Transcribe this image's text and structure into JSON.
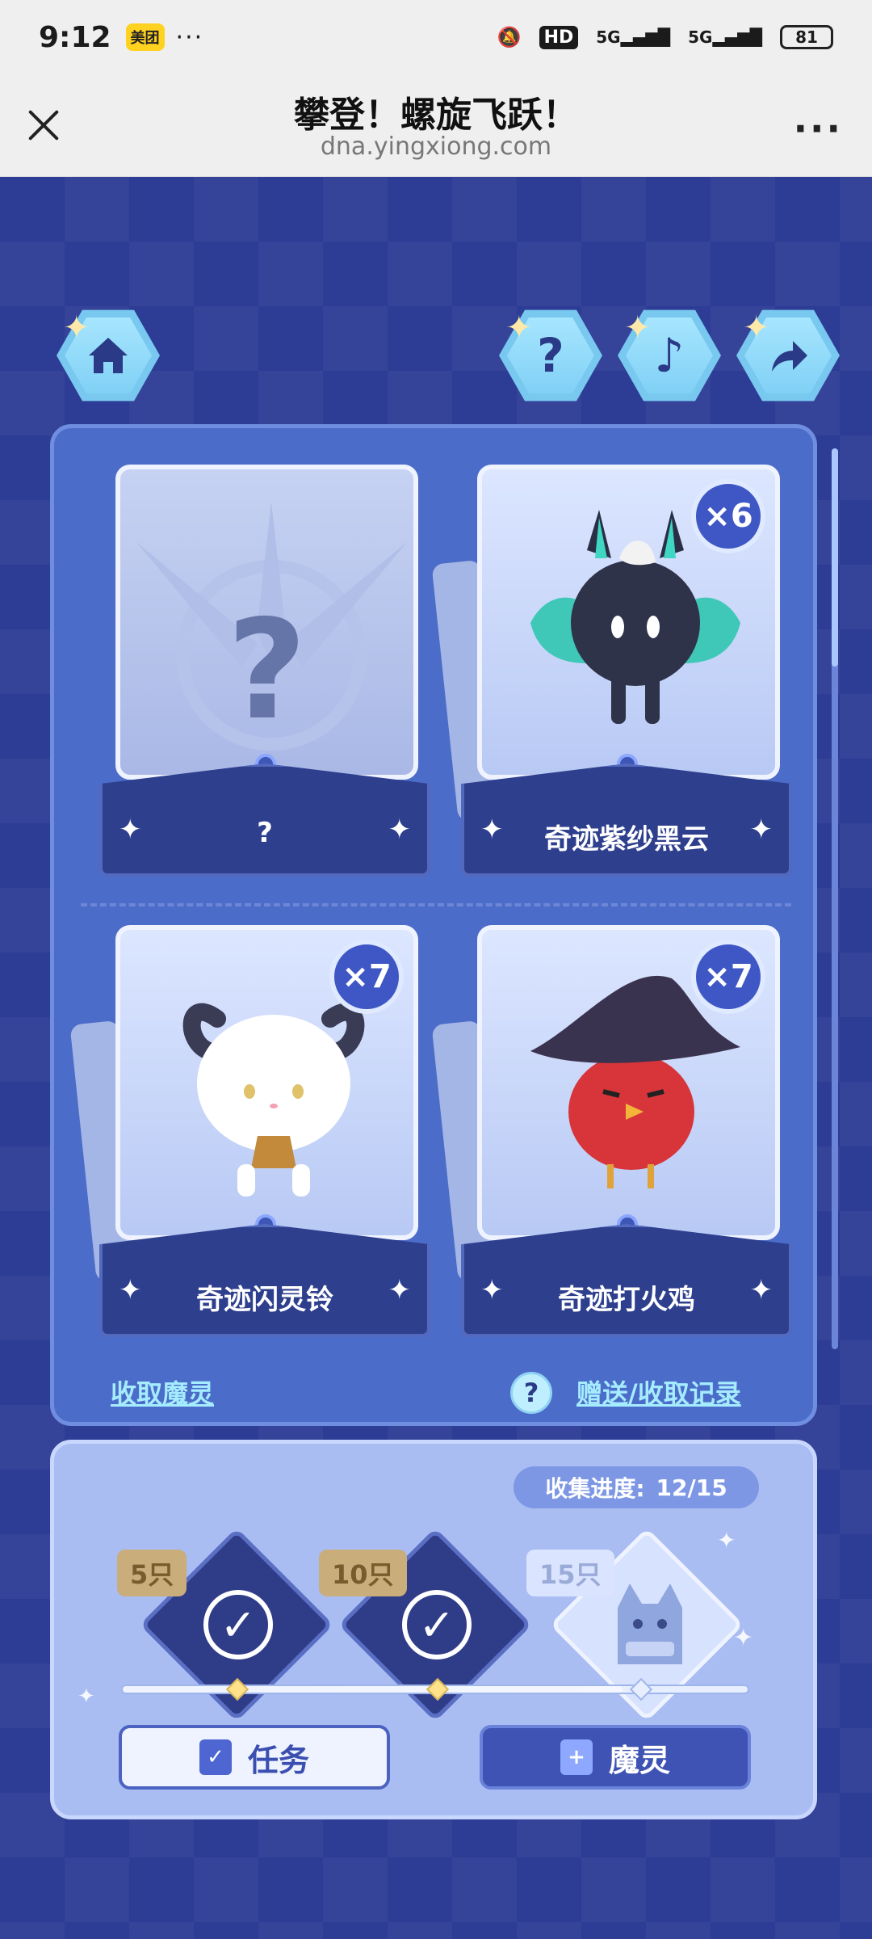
{
  "status_bar": {
    "time": "9:12",
    "app_badge": "美团",
    "more": "···",
    "network_1": "5G",
    "network_2": "5G",
    "hd": "HD",
    "battery": "81"
  },
  "title_bar": {
    "title": "攀登！螺旋飞跃！",
    "url": "dna.yingxiong.com",
    "more": "···"
  },
  "top_icons": {
    "home": "home-icon",
    "help": "?",
    "music": "♪",
    "share": "share-icon"
  },
  "cards": [
    {
      "label": "?",
      "count": "",
      "unknown": true
    },
    {
      "label": "奇迹紫纱黑云",
      "count": "×6"
    },
    {
      "label": "奇迹闪灵铃",
      "count": "×7"
    },
    {
      "label": "奇迹打火鸡",
      "count": "×7"
    }
  ],
  "links": {
    "receive": "收取魔灵",
    "help_icon": "?",
    "records": "赠送/收取记录"
  },
  "progress": {
    "label": "收集进度:",
    "value": "12/15",
    "milestones": [
      {
        "tag": "5只",
        "done": true
      },
      {
        "tag": "10只",
        "done": true
      },
      {
        "tag": "15只",
        "done": false
      }
    ],
    "fraction": 0.8
  },
  "buttons": {
    "task": "任务",
    "spirit": "魔灵"
  },
  "colors": {
    "background": "#2d3c94",
    "panel": "#4c6cc9",
    "accent_link": "#a5ecff",
    "bottom_panel": "#a9bdf3"
  }
}
